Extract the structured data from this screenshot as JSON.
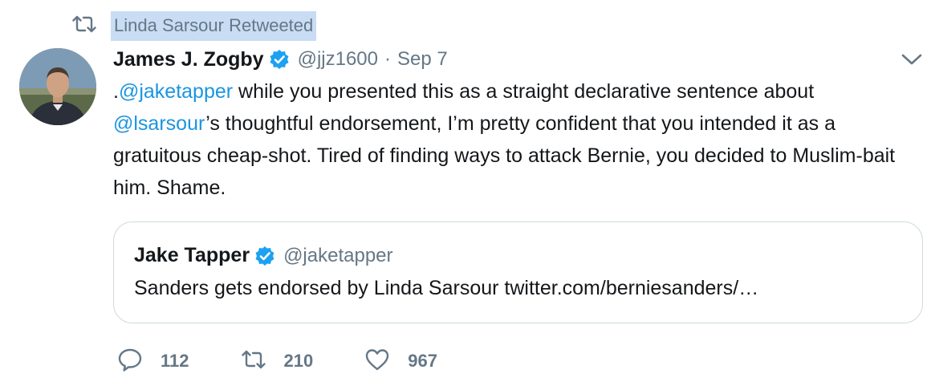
{
  "retweet": {
    "label": "Linda Sarsour Retweeted",
    "icon": "retweet-icon"
  },
  "tweet": {
    "author_name": "James J. Zogby",
    "verified": true,
    "handle": "@jjz1600",
    "separator": "·",
    "date": "Sep 7",
    "text_segments": [
      {
        "text": ".",
        "type": "text"
      },
      {
        "text": "@jaketapper",
        "type": "mention"
      },
      {
        "text": " while you presented this as a straight declarative sentence about ",
        "type": "text"
      },
      {
        "text": "@lsarsour",
        "type": "mention"
      },
      {
        "text": "’s thoughtful endorsement, I’m pretty confident that you intended it as a gratuitous cheap-shot. Tired of finding ways to attack Bernie, you decided to Muslim-bait him. Shame.",
        "type": "text"
      }
    ]
  },
  "quoted": {
    "author_name": "Jake Tapper",
    "verified": true,
    "handle": "@jaketapper",
    "text": "Sanders gets endorsed by Linda Sarsour twitter.com/berniesanders/…"
  },
  "actions": {
    "replies": "112",
    "retweets": "210",
    "likes": "967"
  },
  "colors": {
    "link": "#1b95e0",
    "verified": "#1da1f2",
    "secondary_text": "#657786",
    "highlight": "#c8dcf3"
  }
}
